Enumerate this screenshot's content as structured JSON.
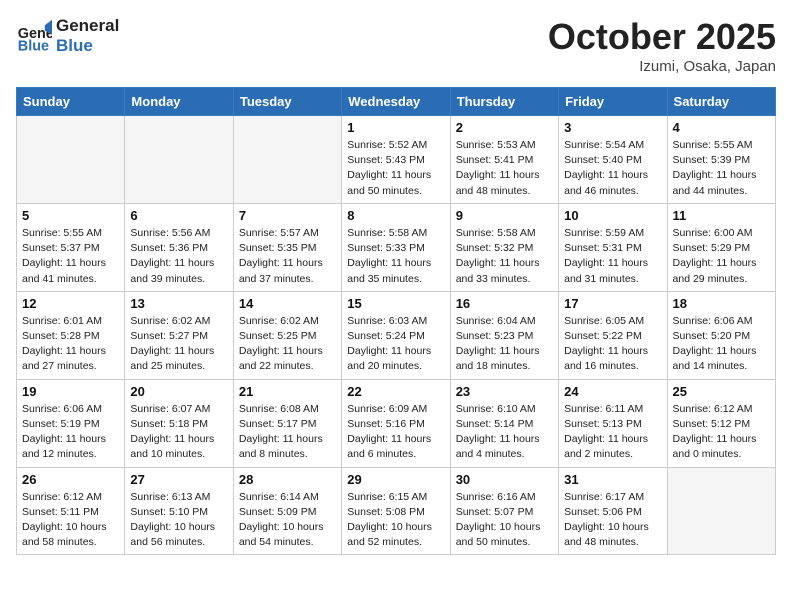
{
  "header": {
    "logo_line1": "General",
    "logo_line2": "Blue",
    "month": "October 2025",
    "location": "Izumi, Osaka, Japan"
  },
  "weekdays": [
    "Sunday",
    "Monday",
    "Tuesday",
    "Wednesday",
    "Thursday",
    "Friday",
    "Saturday"
  ],
  "weeks": [
    [
      {
        "day": "",
        "info": ""
      },
      {
        "day": "",
        "info": ""
      },
      {
        "day": "",
        "info": ""
      },
      {
        "day": "1",
        "info": "Sunrise: 5:52 AM\nSunset: 5:43 PM\nDaylight: 11 hours\nand 50 minutes."
      },
      {
        "day": "2",
        "info": "Sunrise: 5:53 AM\nSunset: 5:41 PM\nDaylight: 11 hours\nand 48 minutes."
      },
      {
        "day": "3",
        "info": "Sunrise: 5:54 AM\nSunset: 5:40 PM\nDaylight: 11 hours\nand 46 minutes."
      },
      {
        "day": "4",
        "info": "Sunrise: 5:55 AM\nSunset: 5:39 PM\nDaylight: 11 hours\nand 44 minutes."
      }
    ],
    [
      {
        "day": "5",
        "info": "Sunrise: 5:55 AM\nSunset: 5:37 PM\nDaylight: 11 hours\nand 41 minutes."
      },
      {
        "day": "6",
        "info": "Sunrise: 5:56 AM\nSunset: 5:36 PM\nDaylight: 11 hours\nand 39 minutes."
      },
      {
        "day": "7",
        "info": "Sunrise: 5:57 AM\nSunset: 5:35 PM\nDaylight: 11 hours\nand 37 minutes."
      },
      {
        "day": "8",
        "info": "Sunrise: 5:58 AM\nSunset: 5:33 PM\nDaylight: 11 hours\nand 35 minutes."
      },
      {
        "day": "9",
        "info": "Sunrise: 5:58 AM\nSunset: 5:32 PM\nDaylight: 11 hours\nand 33 minutes."
      },
      {
        "day": "10",
        "info": "Sunrise: 5:59 AM\nSunset: 5:31 PM\nDaylight: 11 hours\nand 31 minutes."
      },
      {
        "day": "11",
        "info": "Sunrise: 6:00 AM\nSunset: 5:29 PM\nDaylight: 11 hours\nand 29 minutes."
      }
    ],
    [
      {
        "day": "12",
        "info": "Sunrise: 6:01 AM\nSunset: 5:28 PM\nDaylight: 11 hours\nand 27 minutes."
      },
      {
        "day": "13",
        "info": "Sunrise: 6:02 AM\nSunset: 5:27 PM\nDaylight: 11 hours\nand 25 minutes."
      },
      {
        "day": "14",
        "info": "Sunrise: 6:02 AM\nSunset: 5:25 PM\nDaylight: 11 hours\nand 22 minutes."
      },
      {
        "day": "15",
        "info": "Sunrise: 6:03 AM\nSunset: 5:24 PM\nDaylight: 11 hours\nand 20 minutes."
      },
      {
        "day": "16",
        "info": "Sunrise: 6:04 AM\nSunset: 5:23 PM\nDaylight: 11 hours\nand 18 minutes."
      },
      {
        "day": "17",
        "info": "Sunrise: 6:05 AM\nSunset: 5:22 PM\nDaylight: 11 hours\nand 16 minutes."
      },
      {
        "day": "18",
        "info": "Sunrise: 6:06 AM\nSunset: 5:20 PM\nDaylight: 11 hours\nand 14 minutes."
      }
    ],
    [
      {
        "day": "19",
        "info": "Sunrise: 6:06 AM\nSunset: 5:19 PM\nDaylight: 11 hours\nand 12 minutes."
      },
      {
        "day": "20",
        "info": "Sunrise: 6:07 AM\nSunset: 5:18 PM\nDaylight: 11 hours\nand 10 minutes."
      },
      {
        "day": "21",
        "info": "Sunrise: 6:08 AM\nSunset: 5:17 PM\nDaylight: 11 hours\nand 8 minutes."
      },
      {
        "day": "22",
        "info": "Sunrise: 6:09 AM\nSunset: 5:16 PM\nDaylight: 11 hours\nand 6 minutes."
      },
      {
        "day": "23",
        "info": "Sunrise: 6:10 AM\nSunset: 5:14 PM\nDaylight: 11 hours\nand 4 minutes."
      },
      {
        "day": "24",
        "info": "Sunrise: 6:11 AM\nSunset: 5:13 PM\nDaylight: 11 hours\nand 2 minutes."
      },
      {
        "day": "25",
        "info": "Sunrise: 6:12 AM\nSunset: 5:12 PM\nDaylight: 11 hours\nand 0 minutes."
      }
    ],
    [
      {
        "day": "26",
        "info": "Sunrise: 6:12 AM\nSunset: 5:11 PM\nDaylight: 10 hours\nand 58 minutes."
      },
      {
        "day": "27",
        "info": "Sunrise: 6:13 AM\nSunset: 5:10 PM\nDaylight: 10 hours\nand 56 minutes."
      },
      {
        "day": "28",
        "info": "Sunrise: 6:14 AM\nSunset: 5:09 PM\nDaylight: 10 hours\nand 54 minutes."
      },
      {
        "day": "29",
        "info": "Sunrise: 6:15 AM\nSunset: 5:08 PM\nDaylight: 10 hours\nand 52 minutes."
      },
      {
        "day": "30",
        "info": "Sunrise: 6:16 AM\nSunset: 5:07 PM\nDaylight: 10 hours\nand 50 minutes."
      },
      {
        "day": "31",
        "info": "Sunrise: 6:17 AM\nSunset: 5:06 PM\nDaylight: 10 hours\nand 48 minutes."
      },
      {
        "day": "",
        "info": ""
      }
    ]
  ]
}
